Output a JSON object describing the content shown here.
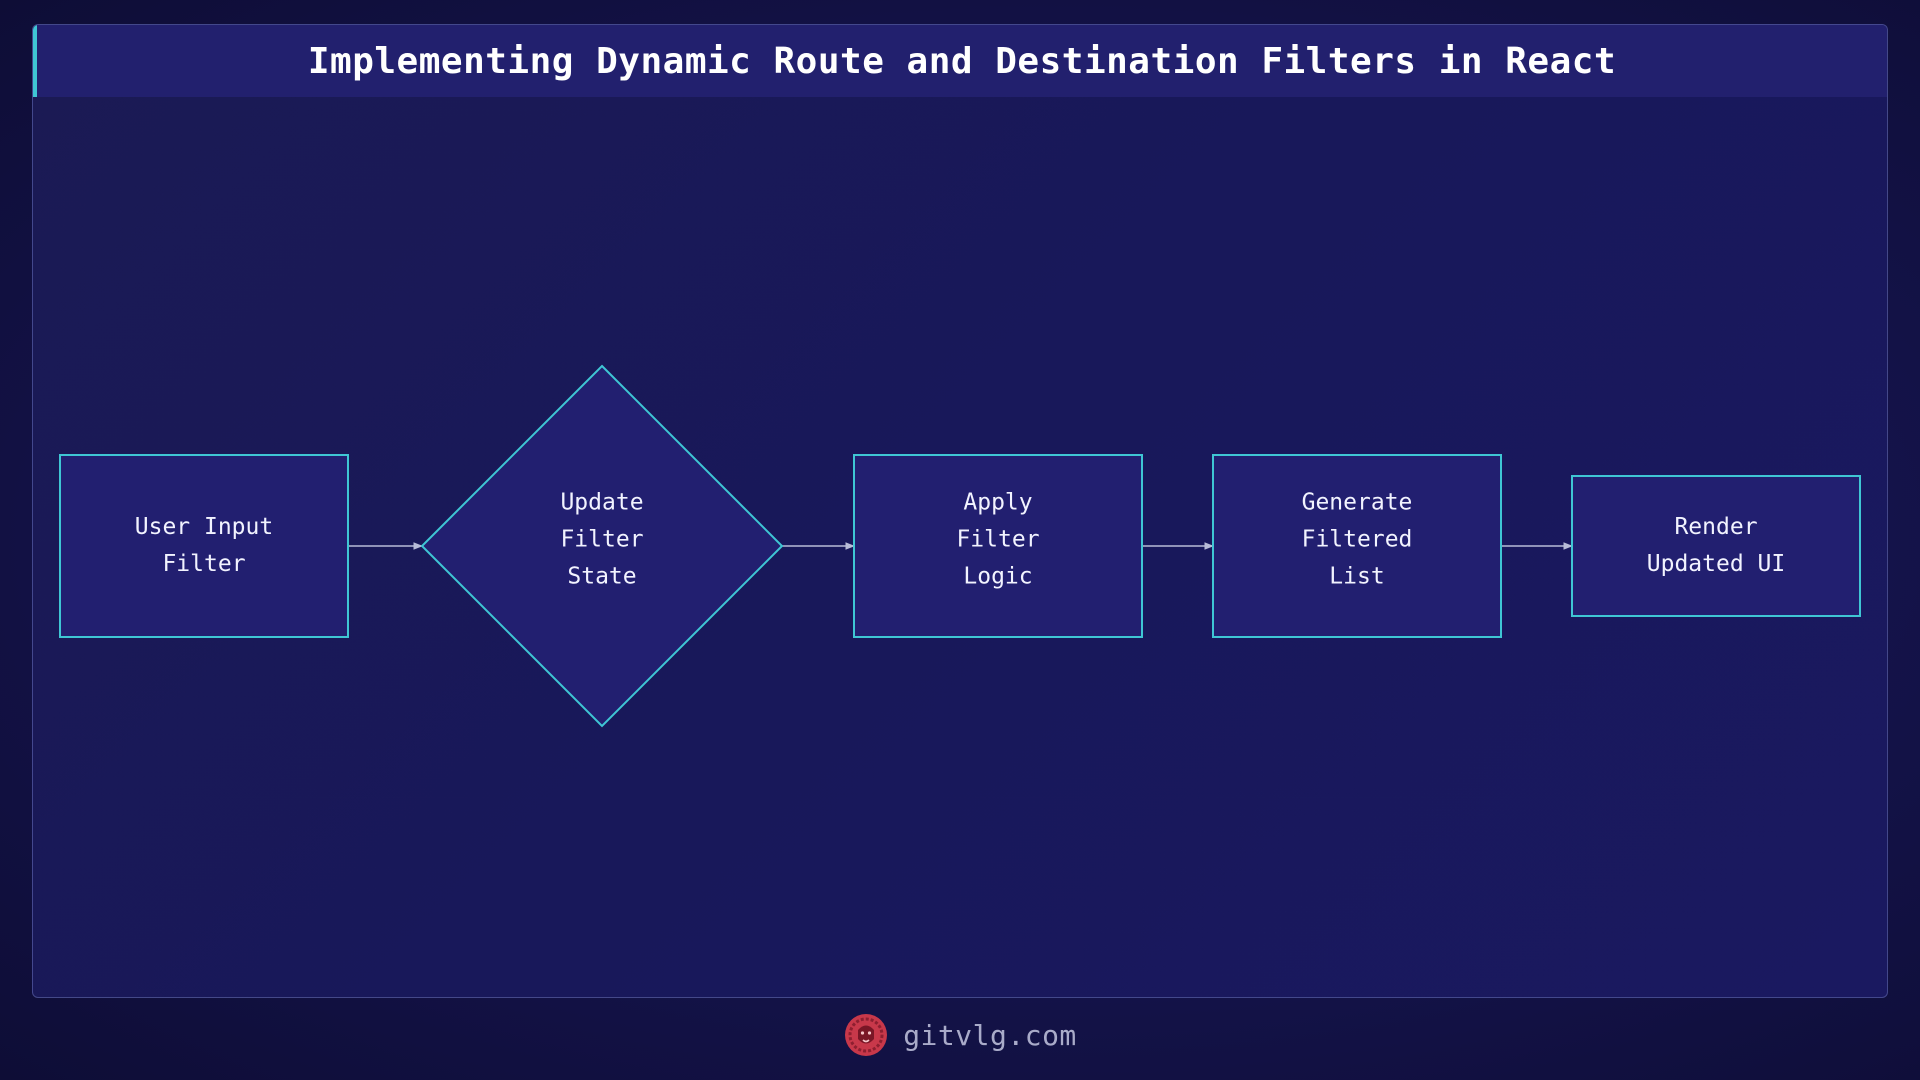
{
  "title": "Implementing Dynamic Route and Destination Filters in React",
  "nodes": [
    {
      "id": "user-input-filter",
      "shape": "rectangle",
      "lines": [
        "User Input",
        "Filter"
      ]
    },
    {
      "id": "update-filter-state",
      "shape": "diamond",
      "lines": [
        "Update",
        "Filter",
        "State"
      ]
    },
    {
      "id": "apply-filter-logic",
      "shape": "rectangle",
      "lines": [
        "Apply",
        "Filter",
        "Logic"
      ]
    },
    {
      "id": "generate-filtered-list",
      "shape": "rectangle",
      "lines": [
        "Generate",
        "Filtered",
        "List"
      ]
    },
    {
      "id": "render-updated-ui",
      "shape": "rectangle",
      "lines": [
        "Render",
        "Updated UI"
      ]
    }
  ],
  "edges": [
    {
      "from": "user-input-filter",
      "to": "update-filter-state"
    },
    {
      "from": "update-filter-state",
      "to": "apply-filter-logic"
    },
    {
      "from": "apply-filter-logic",
      "to": "generate-filtered-list"
    },
    {
      "from": "generate-filtered-list",
      "to": "render-updated-ui"
    }
  ],
  "colors": {
    "node_fill": "#221f70",
    "node_stroke": "#3fc6d4",
    "edge": "#b8bcd8",
    "title_accent": "#3fc6d4",
    "logo": "#c8384a"
  },
  "footer": {
    "logo_icon": "lion-head-logo-icon",
    "text": "gitvlg.com"
  }
}
